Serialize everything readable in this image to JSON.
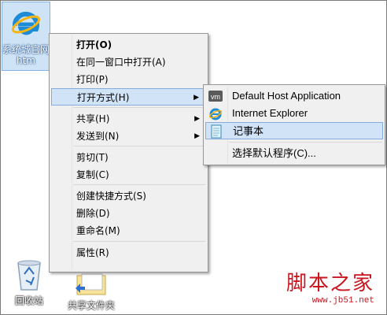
{
  "desktop": {
    "file_icon_label": "系统城官网\nhtm",
    "recycle_label": "回收站",
    "share_label": "共享文件夹"
  },
  "context_menu": {
    "items": [
      {
        "label": "打开(O)",
        "bold": true
      },
      {
        "label": "在同一窗口中打开(A)"
      },
      {
        "label": "打印(P)"
      },
      {
        "label": "打开方式(H)",
        "submenu": true,
        "highlighted": true
      },
      {
        "label": "共享(H)",
        "submenu": true
      },
      {
        "label": "发送到(N)",
        "submenu": true
      },
      {
        "label": "剪切(T)"
      },
      {
        "label": "复制(C)"
      },
      {
        "label": "创建快捷方式(S)"
      },
      {
        "label": "删除(D)"
      },
      {
        "label": "重命名(M)"
      },
      {
        "label": "属性(R)"
      }
    ]
  },
  "open_with_submenu": {
    "items": [
      {
        "label": "Default Host Application",
        "icon": "vm-icon"
      },
      {
        "label": "Internet Explorer",
        "icon": "ie-icon"
      },
      {
        "label": "记事本",
        "icon": "notepad-icon",
        "highlighted": true
      },
      {
        "label": "选择默认程序(C)..."
      }
    ]
  },
  "watermark": {
    "text": "脚本之家",
    "url": "www.jb51.net"
  },
  "colors": {
    "highlight": "#d1e3f7",
    "highlight_border": "#84acdd",
    "menu_bg": "#f0f0f0"
  }
}
